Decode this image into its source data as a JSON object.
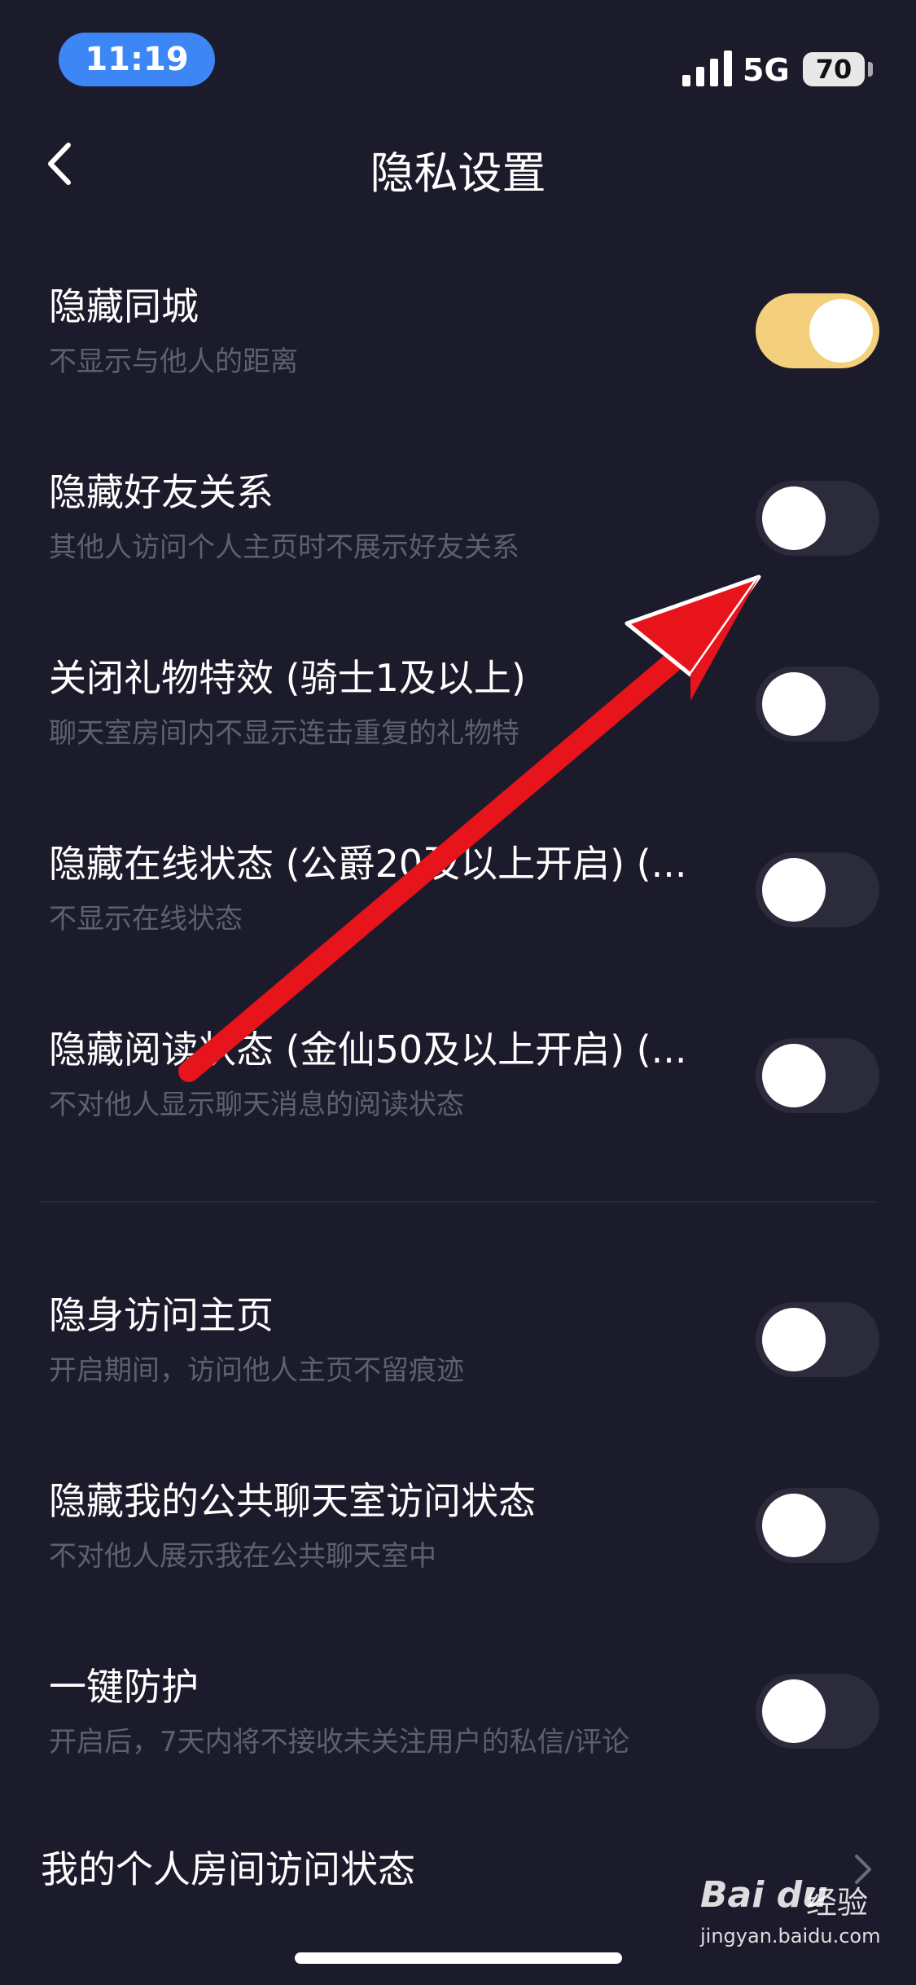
{
  "status_bar": {
    "time": "11:19",
    "network": "5G",
    "battery": "70"
  },
  "header": {
    "title": "隐私设置",
    "back_icon": "chevron-left-icon"
  },
  "settings": [
    {
      "title": "隐藏同城",
      "desc": "不显示与他人的距离",
      "enabled": true
    },
    {
      "title": "隐藏好友关系",
      "desc": "其他人访问个人主页时不展示好友关系",
      "enabled": false
    },
    {
      "title": "关闭礼物特效 (骑士1及以上)",
      "desc": "聊天室房间内不显示连击重复的礼物特",
      "enabled": false
    },
    {
      "title": "隐藏在线状态 (公爵20及以上开启) (...",
      "desc": "不显示在线状态",
      "enabled": false
    },
    {
      "title": "隐藏阅读状态 (金仙50及以上开启) (...",
      "desc": "不对他人显示聊天消息的阅读状态",
      "enabled": false
    },
    {
      "title": "隐身访问主页",
      "desc": "开启期间，访问他人主页不留痕迹",
      "enabled": false
    },
    {
      "title": "隐藏我的公共聊天室访问状态",
      "desc": "不对他人展示我在公共聊天室中",
      "enabled": false
    },
    {
      "title": "一键防护",
      "desc": "开启后，7天内将不接收未关注用户的私信/评论",
      "enabled": false
    }
  ],
  "link_row": {
    "label": "我的个人房间访问状态",
    "icon": "chevron-right-icon"
  },
  "watermark": {
    "logo": "Bai du",
    "text": "经验",
    "url": "jingyan.baidu.com"
  },
  "colors": {
    "background": "#1b1b2b",
    "toggle_on": "#f5d07c",
    "toggle_off": "#2b2b3b",
    "accent_pill": "#3d86f5",
    "arrow": "#e8141b"
  }
}
